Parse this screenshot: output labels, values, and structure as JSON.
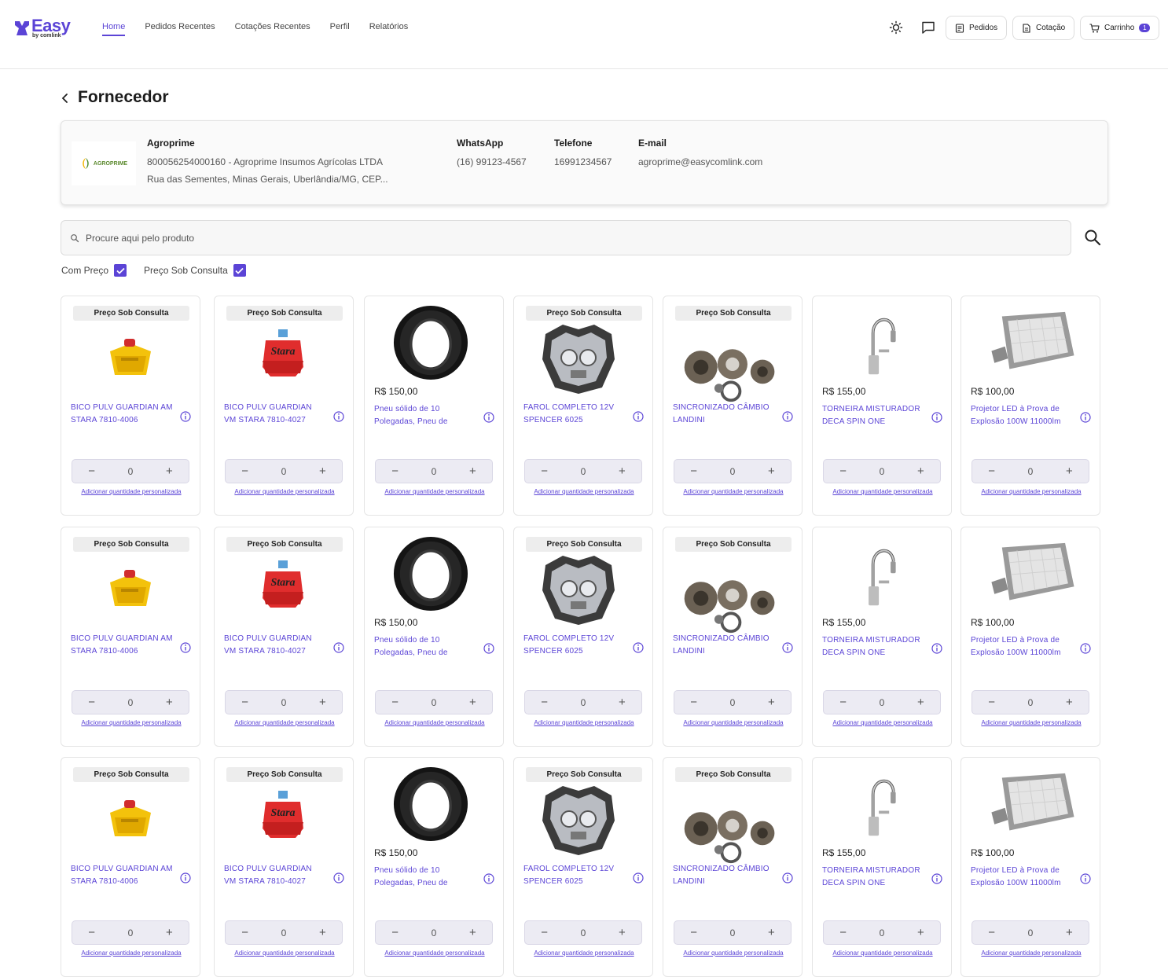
{
  "app": {
    "logo": "Easy",
    "logo_sub": "by comlink"
  },
  "nav": [
    {
      "label": "Home",
      "active": true
    },
    {
      "label": "Pedidos Recentes"
    },
    {
      "label": "Cotações Recentes"
    },
    {
      "label": "Perfil"
    },
    {
      "label": "Relatórios"
    }
  ],
  "header_buttons": {
    "orders": "Pedidos",
    "quote": "Cotação",
    "cart": "Carrinho",
    "cart_count": "1"
  },
  "page": {
    "title": "Fornecedor"
  },
  "supplier": {
    "logo_text": "AGROPRIME",
    "name": "Agroprime",
    "registration": "800056254000160 - Agroprime Insumos Agrícolas LTDA",
    "address": "Rua das Sementes, Minas Gerais, Uberlândia/MG, CEP...",
    "whatsapp_label": "WhatsApp",
    "whatsapp": "(16) 99123-4567",
    "phone_label": "Telefone",
    "phone": "16991234567",
    "email_label": "E-mail",
    "email": "agroprime@easycomlink.com"
  },
  "search": {
    "placeholder": "Procure aqui pelo produto"
  },
  "filters": [
    {
      "label": "Com Preço",
      "checked": true
    },
    {
      "label": "Preço Sob Consulta",
      "checked": true
    }
  ],
  "product_labels": {
    "on_request": "Preço Sob Consulta",
    "custom_qty": "Adicionar quantidade personalizada"
  },
  "products": [
    {
      "kind": "nozzle-yellow",
      "badge": true,
      "price": "",
      "name": "BICO PULV GUARDIAN AM STARA 7810-4006",
      "qty": "0"
    },
    {
      "kind": "nozzle-red",
      "badge": true,
      "price": "",
      "name": "BICO PULV GUARDIAN VM STARA 7810-4027",
      "qty": "0"
    },
    {
      "kind": "tire",
      "badge": false,
      "price": "R$ 150,00",
      "name": "Pneu sólido de 10 Polegadas, Pneu de",
      "qty": "0"
    },
    {
      "kind": "headlight",
      "badge": true,
      "price": "",
      "name": "FAROL COMPLETO 12V SPENCER 6025",
      "qty": "0"
    },
    {
      "kind": "gears",
      "badge": true,
      "price": "",
      "name": "SINCRONIZADO CÂMBIO LANDINI",
      "qty": "0"
    },
    {
      "kind": "faucet",
      "badge": false,
      "price": "R$ 155,00",
      "name": "TORNEIRA MISTURADOR DECA SPIN ONE",
      "qty": "0"
    },
    {
      "kind": "floodlight",
      "badge": false,
      "price": "R$ 100,00",
      "name": "Projetor LED à Prova de Explosão 100W 11000lm",
      "qty": "0"
    }
  ],
  "colors": {
    "accent": "#5b44d6"
  }
}
